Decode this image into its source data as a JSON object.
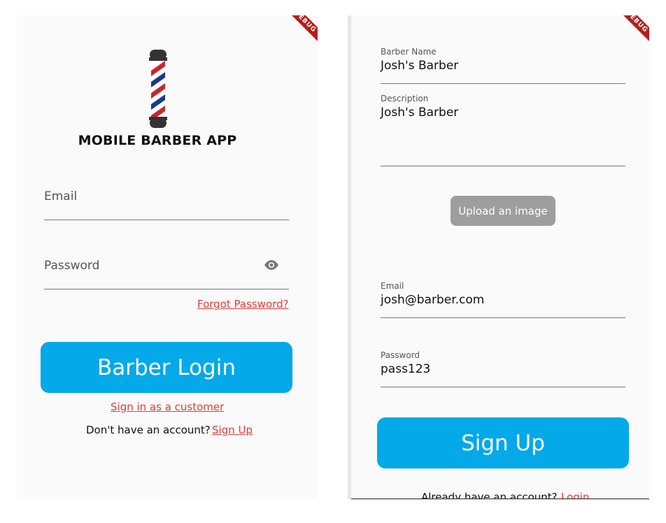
{
  "debug_banner": "DEBUG",
  "login_screen": {
    "app_title": "MOBILE BARBER APP",
    "email_label": "Email",
    "password_label": "Password",
    "forgot_password": "Forgot Password?",
    "login_button": "Barber Login",
    "customer_link": "Sign in as a customer",
    "no_account_text": "Don't have an account?",
    "signup_link": "Sign Up"
  },
  "signup_screen": {
    "barber_name_label": "Barber Name",
    "barber_name_value": "Josh's Barber",
    "description_label": "Description",
    "description_value": "Josh's Barber",
    "upload_button": "Upload an image",
    "email_label": "Email",
    "email_value": "josh@barber.com",
    "password_label": "Password",
    "password_value": "pass123",
    "signup_button": "Sign Up",
    "have_account_text": "Already have an account?",
    "login_link": "Login"
  },
  "colors": {
    "accent": "#03a9e8",
    "link": "#e53935",
    "upload_button": "#9e9e9e",
    "background": "#fafafa"
  }
}
